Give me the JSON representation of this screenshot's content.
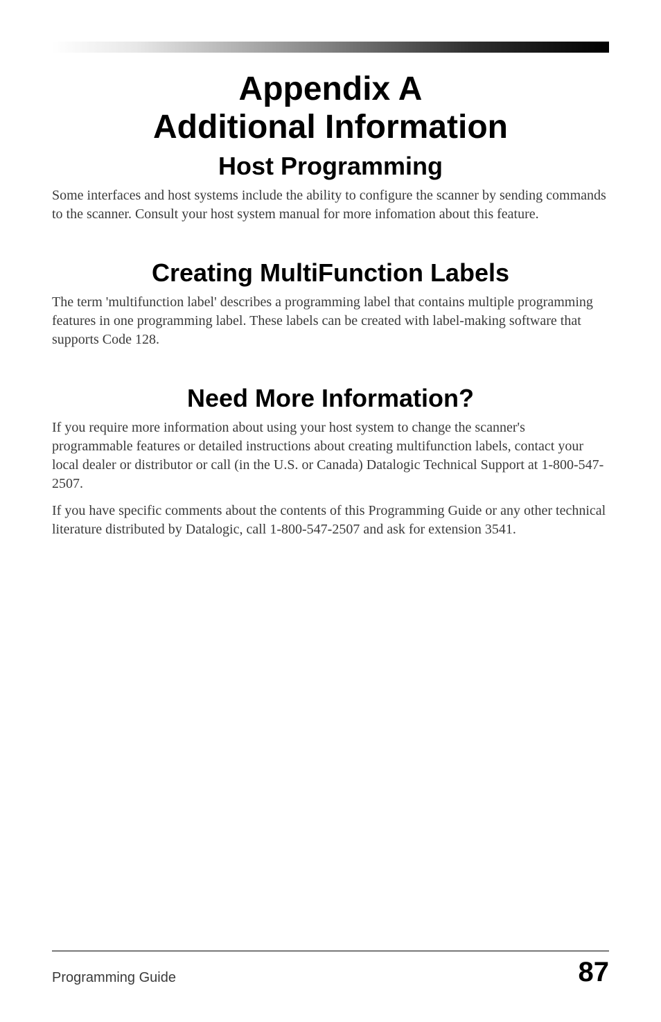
{
  "header": {
    "title_line1": "Appendix A",
    "title_line2": "Additional Information"
  },
  "sections": {
    "host_programming": {
      "title": "Host Programming",
      "body": "Some interfaces and host systems include the ability to configure the scanner by sending commands to the scanner.  Consult your host system manual for more infomation about this feature."
    },
    "multifunction": {
      "title": "Creating MultiFunction Labels",
      "body": "The term 'multifunction label' describes a programming label that contains multiple programming features in one programming label.  These labels can be created with label-making software that supports Code 128."
    },
    "more_info": {
      "title": "Need More Information?",
      "body1": "If you require more information about using your host system to change the scanner's programmable features or detailed instructions about creating multifunction labels, contact your local dealer or distributor or call (in the U.S. or Canada) Datalogic Technical Support at 1-800-547-2507.",
      "body2": "If you have specific comments about the contents of this Programming Guide or any other technical literature distributed by Datalogic, call 1-800-547-2507 and ask for extension 3541."
    }
  },
  "footer": {
    "left": "Programming Guide",
    "page_number": "87"
  }
}
